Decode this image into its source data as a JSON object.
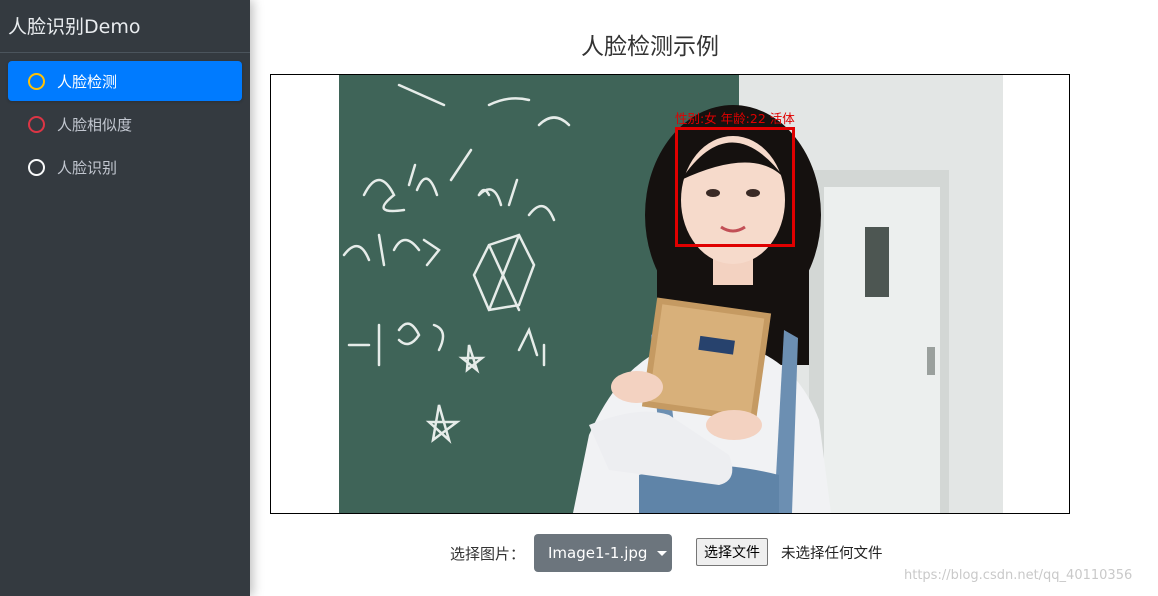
{
  "sidebar": {
    "brand": "人脸识别Demo",
    "items": [
      {
        "label": "人脸检测",
        "active": true,
        "ring_color": "#ffc107"
      },
      {
        "label": "人脸相似度",
        "active": false,
        "ring_color": "#dc3545"
      },
      {
        "label": "人脸识别",
        "active": false,
        "ring_color": "#f8f9fa"
      }
    ]
  },
  "main": {
    "title": "人脸检测示例",
    "detection": {
      "label": "性别:女  年龄:22  活体",
      "box_color": "#e00000"
    },
    "controls": {
      "select_label": "选择图片：",
      "selected_image": "Image1-1.jpg",
      "file_button": "选择文件",
      "file_status": "未选择任何文件"
    },
    "watermark": "https://blog.csdn.net/qq_40110356"
  },
  "colors": {
    "sidebar_bg": "#343a40",
    "active_item": "#007bff",
    "select_button": "#6c757d"
  }
}
